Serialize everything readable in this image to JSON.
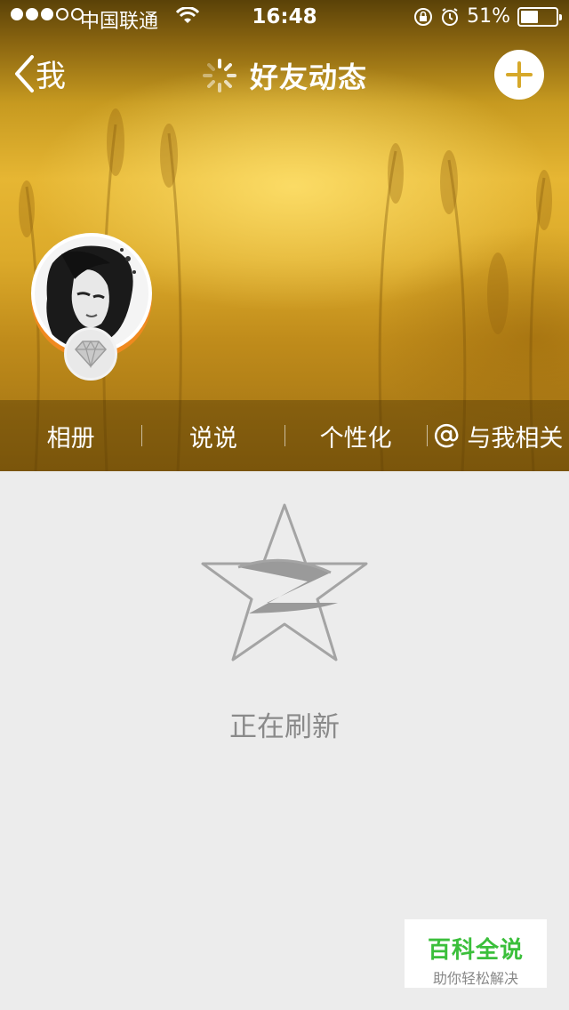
{
  "status_bar": {
    "carrier": "中国联通",
    "time": "16:48",
    "battery": "51%",
    "battery_level": 0.51
  },
  "nav": {
    "back_label": "我",
    "title": "好友动态"
  },
  "tabs": [
    {
      "label": "相册"
    },
    {
      "label": "说说"
    },
    {
      "label": "个性化"
    },
    {
      "label": "与我相关",
      "icon": "at-icon"
    }
  ],
  "loading": {
    "text": "正在刷新"
  },
  "watermark": {
    "title": "百科全说",
    "subtitle": "助你轻松解决"
  },
  "colors": {
    "accent_orange": "#f08a1f",
    "cover_gold": "#e6b633",
    "watermark_green": "#3bbf3b"
  }
}
